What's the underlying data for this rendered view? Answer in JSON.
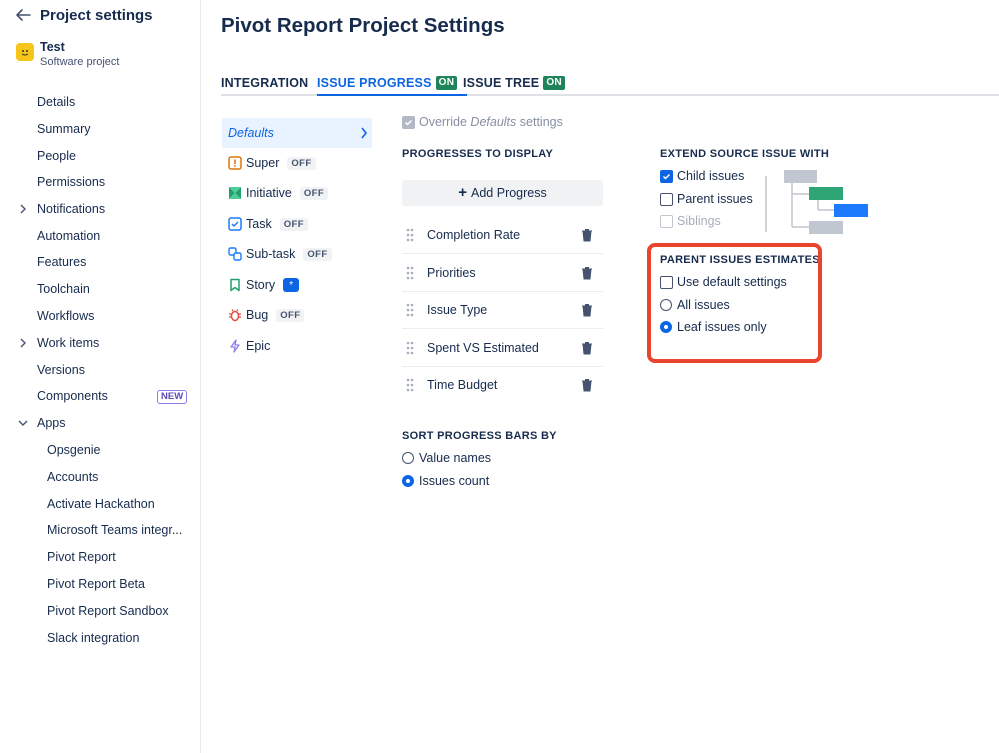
{
  "sidebar": {
    "title": "Project settings",
    "project_name": "Test",
    "project_type": "Software project",
    "items": [
      {
        "label": "Details"
      },
      {
        "label": "Summary"
      },
      {
        "label": "People"
      },
      {
        "label": "Permissions"
      },
      {
        "label": "Notifications"
      },
      {
        "label": "Automation"
      },
      {
        "label": "Features"
      },
      {
        "label": "Toolchain"
      },
      {
        "label": "Workflows"
      },
      {
        "label": "Work items"
      },
      {
        "label": "Versions"
      },
      {
        "label": "Components",
        "badge": "NEW"
      },
      {
        "label": "Apps"
      }
    ],
    "apps": [
      {
        "label": "Opsgenie"
      },
      {
        "label": "Accounts"
      },
      {
        "label": "Activate Hackathon"
      },
      {
        "label": "Microsoft Teams integr..."
      },
      {
        "label": "Pivot Report"
      },
      {
        "label": "Pivot Report Beta"
      },
      {
        "label": "Pivot Report Sandbox"
      },
      {
        "label": "Slack integration"
      }
    ]
  },
  "main": {
    "title": "Pivot Report Project Settings",
    "tabs": [
      {
        "label": "INTEGRATION"
      },
      {
        "label": "ISSUE PROGRESS",
        "lozenge": "ON",
        "active": true
      },
      {
        "label": "ISSUE TREE",
        "lozenge": "ON"
      }
    ],
    "issue_types": [
      {
        "label": "Defaults",
        "selected": true
      },
      {
        "label": "Super",
        "status": "OFF",
        "icon": "super-icon"
      },
      {
        "label": "Initiative",
        "status": "OFF",
        "icon": "initiative-icon"
      },
      {
        "label": "Task",
        "status": "OFF",
        "icon": "task-icon"
      },
      {
        "label": "Sub-task",
        "status": "OFF",
        "icon": "subtask-icon"
      },
      {
        "label": "Story",
        "status": "*",
        "icon": "story-icon"
      },
      {
        "label": "Bug",
        "status": "OFF",
        "icon": "bug-icon"
      },
      {
        "label": "Epic",
        "icon": "epic-icon"
      }
    ],
    "override": {
      "prefix": "Override",
      "emph": "Defaults",
      "suffix": "settings"
    },
    "progresses_label": "PROGRESSES TO DISPLAY",
    "add_progress_label": "Add Progress",
    "progresses": [
      {
        "label": "Completion Rate"
      },
      {
        "label": "Priorities"
      },
      {
        "label": "Issue Type"
      },
      {
        "label": "Spent VS Estimated"
      },
      {
        "label": "Time Budget"
      }
    ],
    "sort_label": "SORT PROGRESS BARS BY",
    "sort_options": [
      {
        "label": "Value names",
        "checked": false
      },
      {
        "label": "Issues count",
        "checked": true
      }
    ],
    "extend_label": "EXTEND SOURCE ISSUE WITH",
    "extend_options": [
      {
        "label": "Child issues",
        "checked": true
      },
      {
        "label": "Parent issues",
        "checked": false
      },
      {
        "label": "Siblings",
        "checked": false,
        "disabled": true
      }
    ],
    "parent_label": "PARENT ISSUES ESTIMATES",
    "parent_default": {
      "label": "Use default settings",
      "checked": false
    },
    "parent_options": [
      {
        "label": "All issues",
        "checked": false
      },
      {
        "label": "Leaf issues only",
        "checked": true
      }
    ]
  },
  "colors": {
    "accent": "#0c66e4",
    "on_lozenge": "#1f845a",
    "highlight": "#e8452c"
  }
}
